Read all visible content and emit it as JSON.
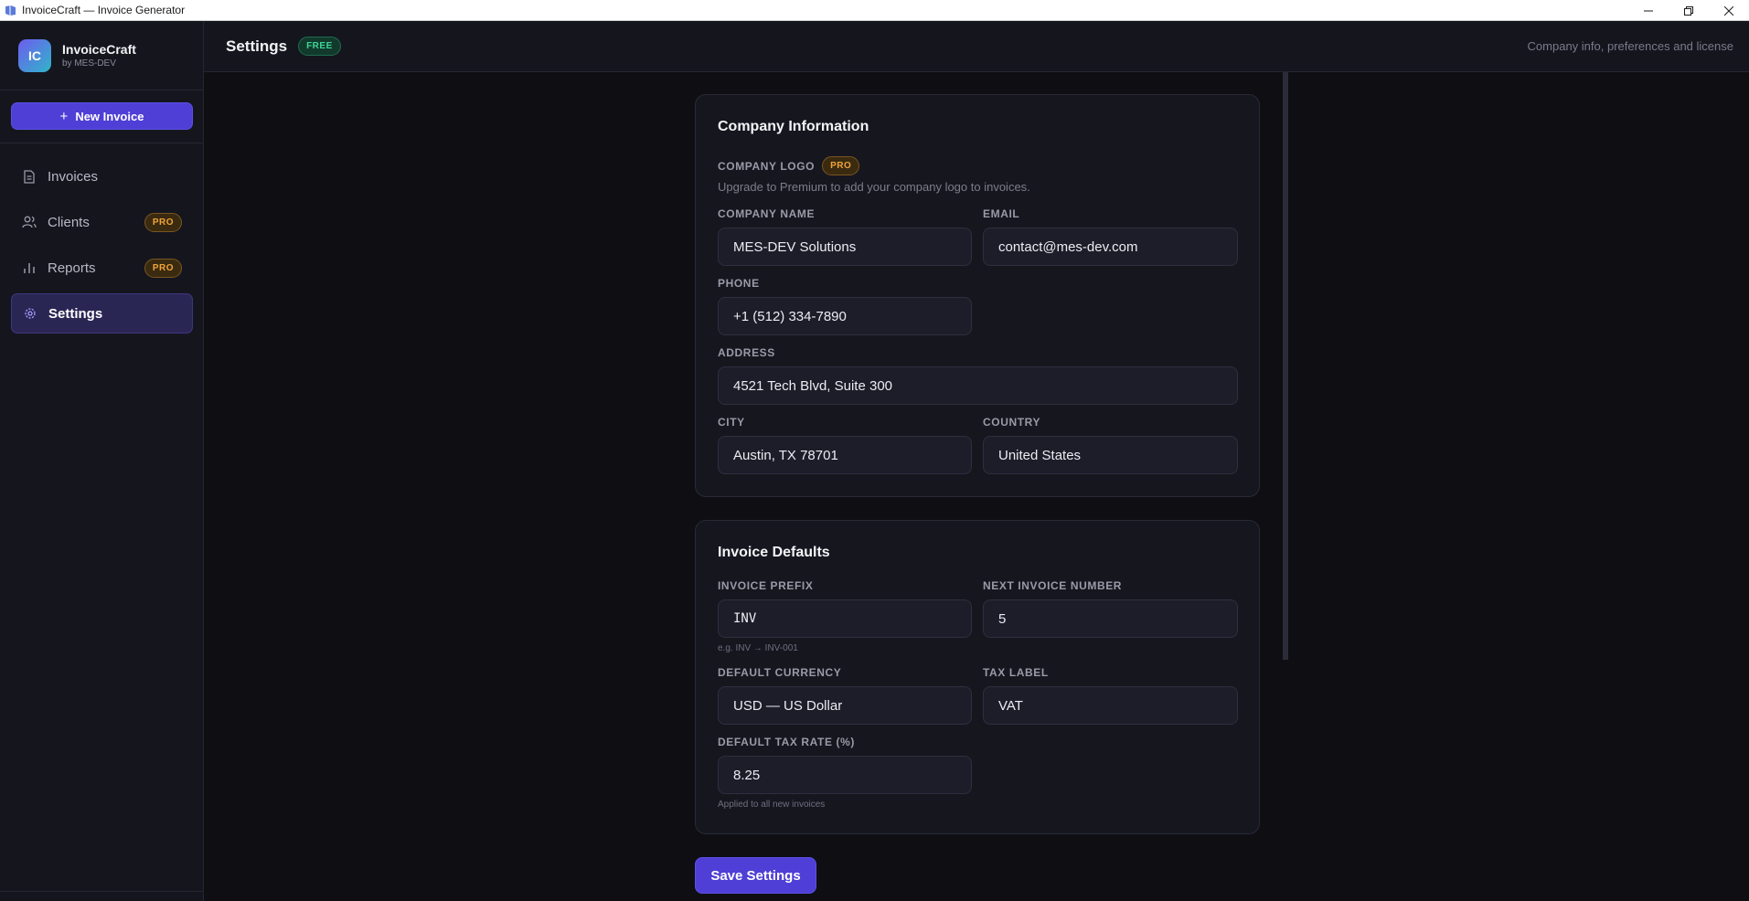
{
  "window": {
    "title": "InvoiceCraft — Invoice Generator",
    "controls": {
      "minimize": "—",
      "restore": "❐",
      "close": "✕"
    }
  },
  "brand": {
    "initials": "IC",
    "name": "InvoiceCraft",
    "subtitle": "by MES-DEV"
  },
  "sidebar": {
    "new_invoice_label": "New Invoice",
    "items": [
      {
        "label": "Invoices",
        "icon": "document-icon",
        "pro": false,
        "active": false
      },
      {
        "label": "Clients",
        "icon": "users-icon",
        "pro": true,
        "active": false
      },
      {
        "label": "Reports",
        "icon": "bar-chart-icon",
        "pro": true,
        "active": false
      },
      {
        "label": "Settings",
        "icon": "gear-icon",
        "pro": false,
        "active": true
      }
    ],
    "pro_label": "PRO"
  },
  "header": {
    "title": "Settings",
    "plan_badge": "FREE",
    "subtitle": "Company info, preferences and license"
  },
  "company": {
    "title": "Company Information",
    "logo_label": "COMPANY LOGO",
    "logo_badge": "PRO",
    "logo_note": "Upgrade to Premium to add your company logo to invoices.",
    "name_label": "COMPANY NAME",
    "name_value": "MES-DEV Solutions",
    "email_label": "EMAIL",
    "email_value": "contact@mes-dev.com",
    "phone_label": "PHONE",
    "phone_value": "+1 (512) 334-7890",
    "address_label": "ADDRESS",
    "address_value": "4521 Tech Blvd, Suite 300",
    "city_label": "CITY",
    "city_value": "Austin, TX 78701",
    "country_label": "COUNTRY",
    "country_value": "United States"
  },
  "defaults": {
    "title": "Invoice Defaults",
    "prefix_label": "INVOICE PREFIX",
    "prefix_value": "INV",
    "prefix_hint": "e.g. INV → INV-001",
    "next_number_label": "NEXT INVOICE NUMBER",
    "next_number_value": "5",
    "currency_label": "DEFAULT CURRENCY",
    "currency_value": "USD — US Dollar",
    "tax_label_label": "TAX LABEL",
    "tax_label_value": "VAT",
    "tax_rate_label": "DEFAULT TAX RATE (%)",
    "tax_rate_value": "8.25",
    "tax_rate_hint": "Applied to all new invoices"
  },
  "save_label": "Save Settings",
  "colors": {
    "accent": "#4f3fd6",
    "pro": "#f0a43a",
    "free": "#3dd598",
    "background": "#0e0e13"
  }
}
